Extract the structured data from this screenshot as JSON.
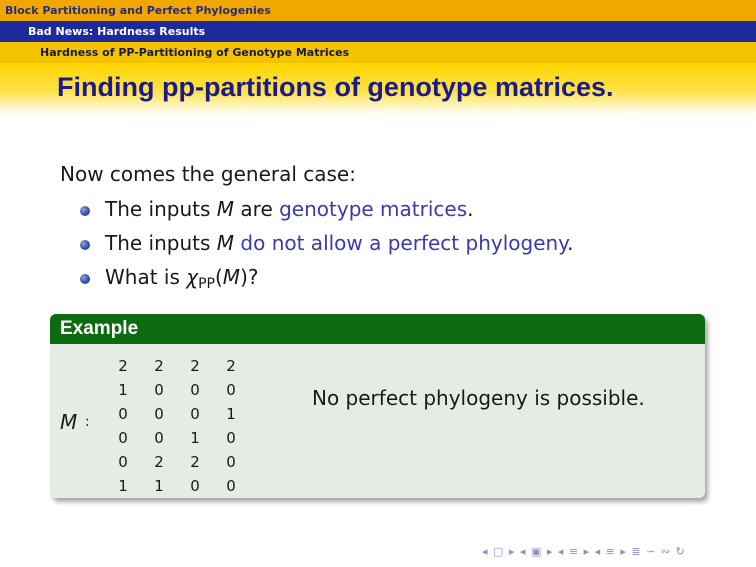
{
  "header": {
    "section": "Block Partitioning and Perfect Phylogenies",
    "subsection": "Bad News: Hardness Results",
    "subsubsection": "Hardness of PP-Partitioning of Genotype Matrices"
  },
  "frame_title": "Finding pp-partitions of genotype matrices.",
  "intro": "Now comes the general case:",
  "bullets": [
    {
      "pre": "The inputs ",
      "var": "M",
      "mid": " are ",
      "highlight": "genotype matrices",
      "post": "."
    },
    {
      "pre": "The inputs ",
      "var": "M",
      "mid": " ",
      "highlight": "do not allow a perfect phylogeny",
      "post": "."
    },
    {
      "pre": "What is ",
      "chi": "χ",
      "sub": "PP",
      "open": "(",
      "var": "M",
      "close": ")?"
    }
  ],
  "example": {
    "title": "Example",
    "matrix_label": "M",
    "colon": ":",
    "matrix": [
      [
        "2",
        "2",
        "2",
        "2"
      ],
      [
        "1",
        "0",
        "0",
        "0"
      ],
      [
        "0",
        "0",
        "0",
        "1"
      ],
      [
        "0",
        "0",
        "1",
        "0"
      ],
      [
        "0",
        "2",
        "2",
        "0"
      ],
      [
        "1",
        "1",
        "0",
        "0"
      ]
    ],
    "text": "No perfect phylogeny is possible."
  },
  "nav_symbols": "◂ ▢ ▸ ◂ ▣ ▸ ◂ ≡ ▸ ◂ ≡ ▸ ≣ ∽ ∾ ↻",
  "colors": {
    "header1": "#f0a800",
    "header2": "#1c2a9c",
    "header3": "#f3c300",
    "title": "#1a1a8c",
    "highlight": "#3a3ab0",
    "block_title": "#0f6b0f",
    "block_body": "#e4ece4"
  }
}
